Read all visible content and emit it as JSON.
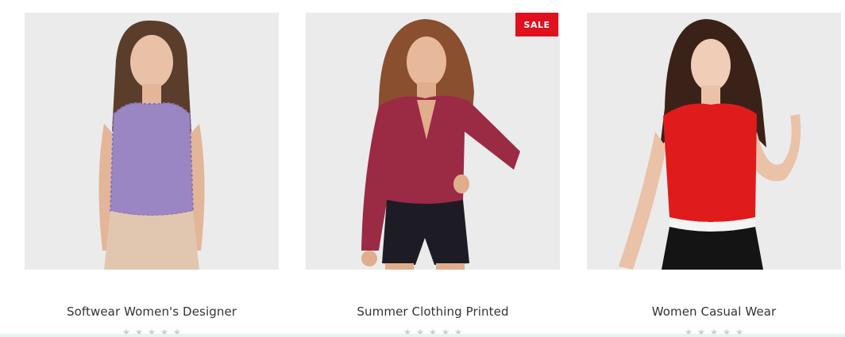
{
  "products": [
    {
      "title": "Softwear Women's Designer",
      "sale": false,
      "rating": 0,
      "rating_max": 5,
      "image": "model in purple lace sleeveless top"
    },
    {
      "title": "Summer Clothing Printed",
      "sale": true,
      "sale_label": "SALE",
      "rating": 0,
      "rating_max": 5,
      "image": "model in burgundy blouse and black shorts"
    },
    {
      "title": "Women Casual Wear",
      "sale": false,
      "rating": 0,
      "rating_max": 5,
      "image": "model in red sleeveless shirt and black skirt"
    }
  ],
  "colors": {
    "sale_badge": "#e0101e",
    "image_bg": "#ebebeb",
    "title_text": "#333333",
    "star_empty": "#cfcfcf"
  },
  "icons": {
    "rating": "star-icon"
  }
}
